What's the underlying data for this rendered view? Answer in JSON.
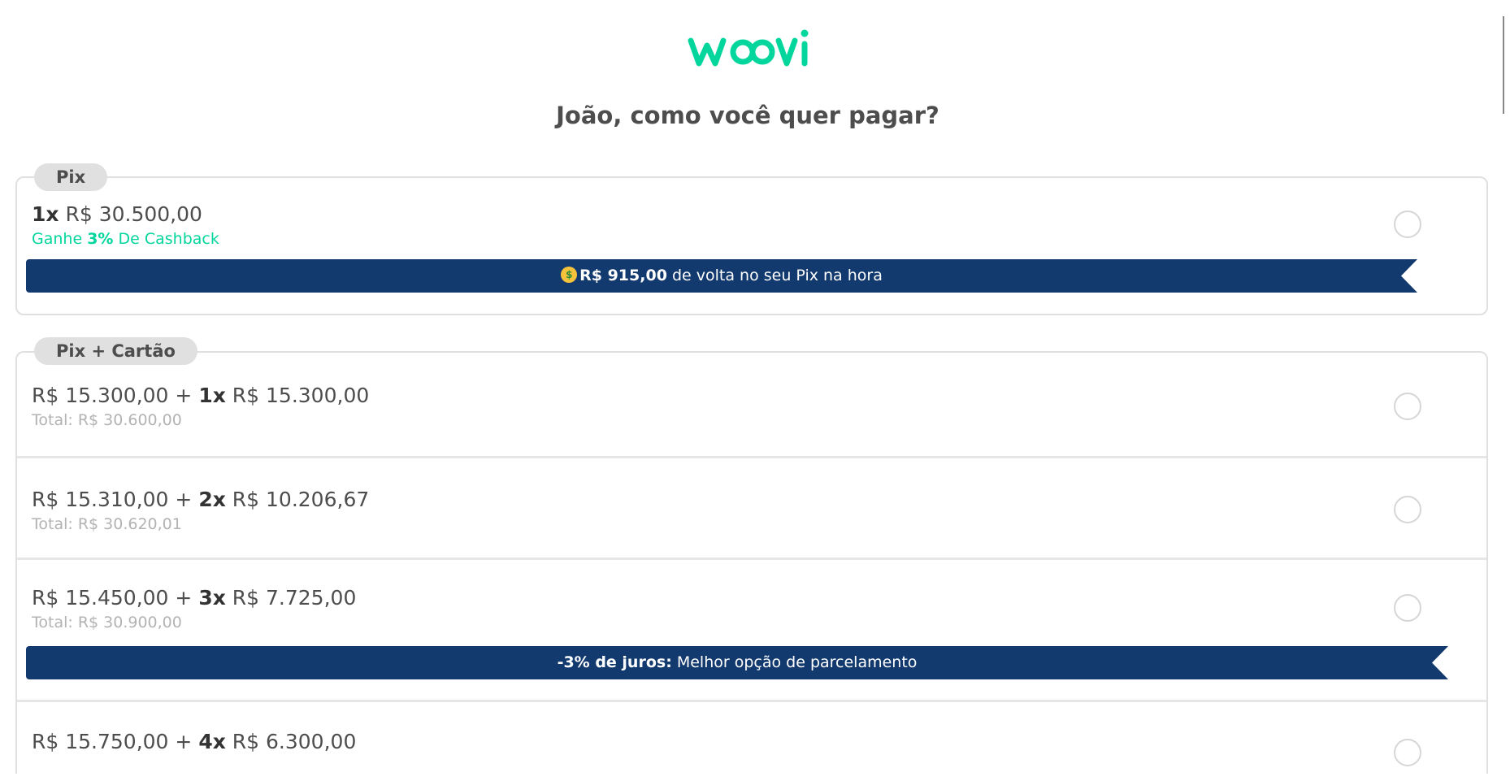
{
  "brand": {
    "name": "woovi",
    "color": "#03d69d"
  },
  "page_title": "João, como você quer pagar?",
  "sections": {
    "pix": {
      "tag": "Pix",
      "option": {
        "count": "1x",
        "amount": "R$ 30.500,00",
        "cashback_prefix": "Ganhe",
        "cashback_percent": "3%",
        "cashback_suffix": "De Cashback",
        "banner_amount": "R$ 915,00",
        "banner_text": " de volta no seu Pix na hora"
      }
    },
    "pix_card": {
      "tag": "Pix + Cartão",
      "options": [
        {
          "pix": "R$ 15.300,00",
          "plus": " + ",
          "count": "1x",
          "installment": "R$ 15.300,00",
          "total": "Total: R$ 30.600,00"
        },
        {
          "pix": "R$ 15.310,00",
          "plus": " + ",
          "count": "2x",
          "installment": "R$ 10.206,67",
          "total": "Total: R$ 30.620,01"
        },
        {
          "pix": "R$ 15.450,00",
          "plus": " + ",
          "count": "3x",
          "installment": "R$ 7.725,00",
          "total": "Total: R$ 30.900,00",
          "banner_bold": "-3% de juros:",
          "banner_text": " Melhor opção de parcelamento"
        },
        {
          "pix": "R$ 15.750,00",
          "plus": " + ",
          "count": "4x",
          "installment": "R$ 6.300,00"
        }
      ]
    }
  },
  "colors": {
    "banner": "#133a6f",
    "accent": "#03d69d",
    "tag_bg": "#e0e0e0"
  }
}
